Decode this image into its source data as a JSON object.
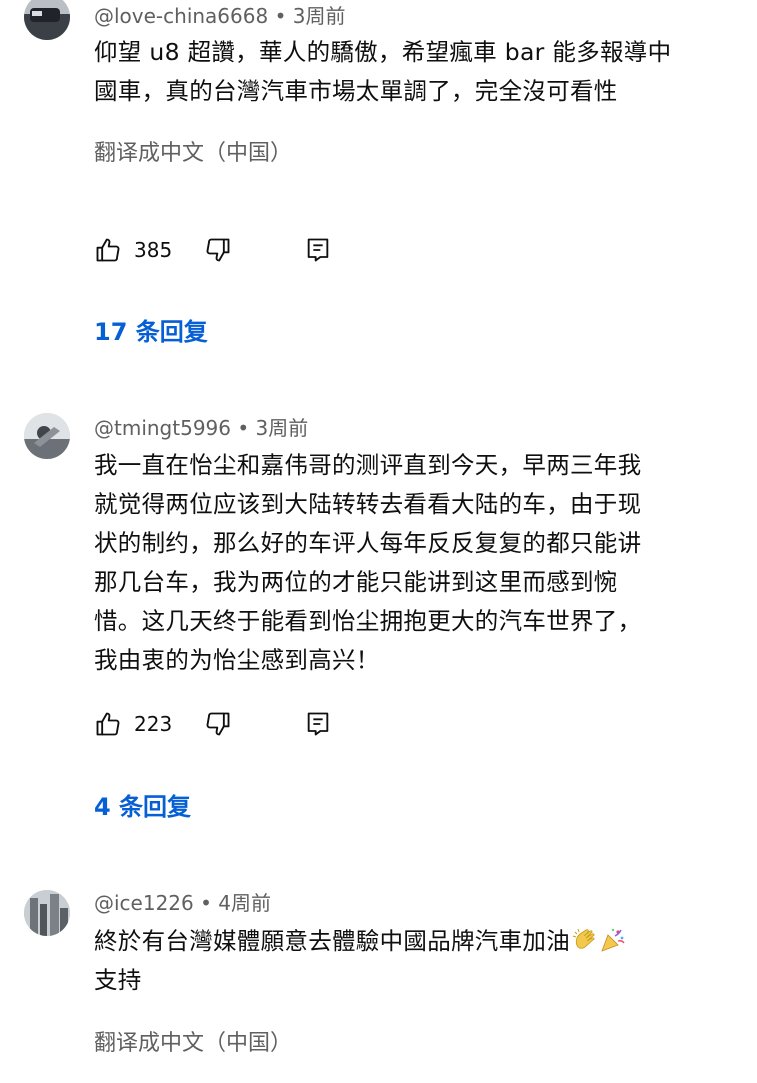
{
  "comments": [
    {
      "author": "@love-china6668",
      "time": "3周前",
      "lines": [
        "仰望 u8 超讚，華人的驕傲，希望瘋車 bar 能多報導中",
        "國車，真的台灣汽車市場太單調了，完全沒可看性"
      ],
      "translate": "翻译成中文（中国）",
      "likes": "385",
      "replies": "17 条回复"
    },
    {
      "author": "@tmingt5996",
      "time": "3周前",
      "lines": [
        "我一直在怡尘和嘉伟哥的测评直到今天，早两三年我",
        "就觉得两位应该到大陆转转去看看大陆的车，由于现",
        "状的制约，那么好的车评人每年反反复复的都只能讲",
        "那几台车，我为两位的才能只能讲到这里而感到惋",
        "惜。这几天终于能看到怡尘拥抱更大的汽车世界了，",
        "我由衷的为怡尘感到高兴！"
      ],
      "likes": "223",
      "replies": "4 条回复"
    },
    {
      "author": "@ice1226",
      "time": "4周前",
      "lines": [
        "終於有台灣媒體願意去體驗中國品牌汽車加油",
        "支持"
      ],
      "emojis": [
        "clapping-hands-icon",
        "party-popper-icon"
      ],
      "translate": "翻译成中文（中国）"
    }
  ],
  "separator": " • "
}
